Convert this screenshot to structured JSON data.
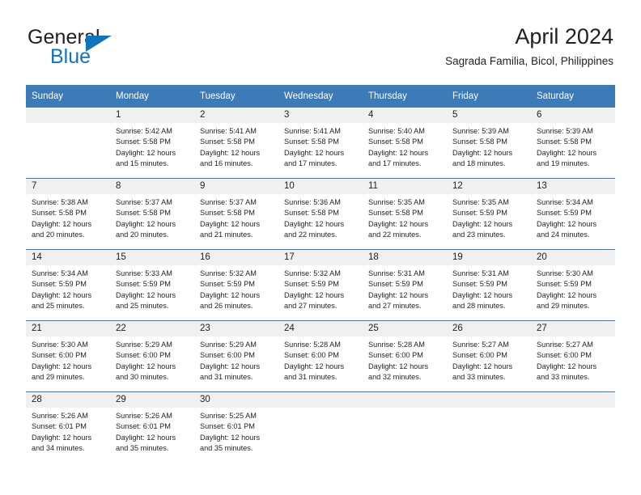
{
  "brand": {
    "name_top": "General",
    "name_bottom": "Blue",
    "triangle_color": "#1073bd"
  },
  "header": {
    "title": "April 2024",
    "subtitle": "Sagrada Familia, Bicol, Philippines"
  },
  "theme": {
    "header_blue": "#3c7ab8",
    "daynum_band": "#f0f0f0",
    "text": "#231f20"
  },
  "calendar": {
    "weekday_headers": [
      "Sunday",
      "Monday",
      "Tuesday",
      "Wednesday",
      "Thursday",
      "Friday",
      "Saturday"
    ],
    "labels": {
      "sunrise_prefix": "Sunrise:",
      "sunset_prefix": "Sunset:",
      "daylight_prefix": "Daylight:"
    },
    "weeks": [
      [
        {
          "day": "",
          "empty": true,
          "sunrise": "",
          "sunset": "",
          "daylight_line1": "",
          "daylight_line2": ""
        },
        {
          "day": "1",
          "empty": false,
          "sunrise": "Sunrise: 5:42 AM",
          "sunset": "Sunset: 5:58 PM",
          "daylight_line1": "Daylight: 12 hours",
          "daylight_line2": "and 15 minutes."
        },
        {
          "day": "2",
          "empty": false,
          "sunrise": "Sunrise: 5:41 AM",
          "sunset": "Sunset: 5:58 PM",
          "daylight_line1": "Daylight: 12 hours",
          "daylight_line2": "and 16 minutes."
        },
        {
          "day": "3",
          "empty": false,
          "sunrise": "Sunrise: 5:41 AM",
          "sunset": "Sunset: 5:58 PM",
          "daylight_line1": "Daylight: 12 hours",
          "daylight_line2": "and 17 minutes."
        },
        {
          "day": "4",
          "empty": false,
          "sunrise": "Sunrise: 5:40 AM",
          "sunset": "Sunset: 5:58 PM",
          "daylight_line1": "Daylight: 12 hours",
          "daylight_line2": "and 17 minutes."
        },
        {
          "day": "5",
          "empty": false,
          "sunrise": "Sunrise: 5:39 AM",
          "sunset": "Sunset: 5:58 PM",
          "daylight_line1": "Daylight: 12 hours",
          "daylight_line2": "and 18 minutes."
        },
        {
          "day": "6",
          "empty": false,
          "sunrise": "Sunrise: 5:39 AM",
          "sunset": "Sunset: 5:58 PM",
          "daylight_line1": "Daylight: 12 hours",
          "daylight_line2": "and 19 minutes."
        }
      ],
      [
        {
          "day": "7",
          "empty": false,
          "sunrise": "Sunrise: 5:38 AM",
          "sunset": "Sunset: 5:58 PM",
          "daylight_line1": "Daylight: 12 hours",
          "daylight_line2": "and 20 minutes."
        },
        {
          "day": "8",
          "empty": false,
          "sunrise": "Sunrise: 5:37 AM",
          "sunset": "Sunset: 5:58 PM",
          "daylight_line1": "Daylight: 12 hours",
          "daylight_line2": "and 20 minutes."
        },
        {
          "day": "9",
          "empty": false,
          "sunrise": "Sunrise: 5:37 AM",
          "sunset": "Sunset: 5:58 PM",
          "daylight_line1": "Daylight: 12 hours",
          "daylight_line2": "and 21 minutes."
        },
        {
          "day": "10",
          "empty": false,
          "sunrise": "Sunrise: 5:36 AM",
          "sunset": "Sunset: 5:58 PM",
          "daylight_line1": "Daylight: 12 hours",
          "daylight_line2": "and 22 minutes."
        },
        {
          "day": "11",
          "empty": false,
          "sunrise": "Sunrise: 5:35 AM",
          "sunset": "Sunset: 5:58 PM",
          "daylight_line1": "Daylight: 12 hours",
          "daylight_line2": "and 22 minutes."
        },
        {
          "day": "12",
          "empty": false,
          "sunrise": "Sunrise: 5:35 AM",
          "sunset": "Sunset: 5:59 PM",
          "daylight_line1": "Daylight: 12 hours",
          "daylight_line2": "and 23 minutes."
        },
        {
          "day": "13",
          "empty": false,
          "sunrise": "Sunrise: 5:34 AM",
          "sunset": "Sunset: 5:59 PM",
          "daylight_line1": "Daylight: 12 hours",
          "daylight_line2": "and 24 minutes."
        }
      ],
      [
        {
          "day": "14",
          "empty": false,
          "sunrise": "Sunrise: 5:34 AM",
          "sunset": "Sunset: 5:59 PM",
          "daylight_line1": "Daylight: 12 hours",
          "daylight_line2": "and 25 minutes."
        },
        {
          "day": "15",
          "empty": false,
          "sunrise": "Sunrise: 5:33 AM",
          "sunset": "Sunset: 5:59 PM",
          "daylight_line1": "Daylight: 12 hours",
          "daylight_line2": "and 25 minutes."
        },
        {
          "day": "16",
          "empty": false,
          "sunrise": "Sunrise: 5:32 AM",
          "sunset": "Sunset: 5:59 PM",
          "daylight_line1": "Daylight: 12 hours",
          "daylight_line2": "and 26 minutes."
        },
        {
          "day": "17",
          "empty": false,
          "sunrise": "Sunrise: 5:32 AM",
          "sunset": "Sunset: 5:59 PM",
          "daylight_line1": "Daylight: 12 hours",
          "daylight_line2": "and 27 minutes."
        },
        {
          "day": "18",
          "empty": false,
          "sunrise": "Sunrise: 5:31 AM",
          "sunset": "Sunset: 5:59 PM",
          "daylight_line1": "Daylight: 12 hours",
          "daylight_line2": "and 27 minutes."
        },
        {
          "day": "19",
          "empty": false,
          "sunrise": "Sunrise: 5:31 AM",
          "sunset": "Sunset: 5:59 PM",
          "daylight_line1": "Daylight: 12 hours",
          "daylight_line2": "and 28 minutes."
        },
        {
          "day": "20",
          "empty": false,
          "sunrise": "Sunrise: 5:30 AM",
          "sunset": "Sunset: 5:59 PM",
          "daylight_line1": "Daylight: 12 hours",
          "daylight_line2": "and 29 minutes."
        }
      ],
      [
        {
          "day": "21",
          "empty": false,
          "sunrise": "Sunrise: 5:30 AM",
          "sunset": "Sunset: 6:00 PM",
          "daylight_line1": "Daylight: 12 hours",
          "daylight_line2": "and 29 minutes."
        },
        {
          "day": "22",
          "empty": false,
          "sunrise": "Sunrise: 5:29 AM",
          "sunset": "Sunset: 6:00 PM",
          "daylight_line1": "Daylight: 12 hours",
          "daylight_line2": "and 30 minutes."
        },
        {
          "day": "23",
          "empty": false,
          "sunrise": "Sunrise: 5:29 AM",
          "sunset": "Sunset: 6:00 PM",
          "daylight_line1": "Daylight: 12 hours",
          "daylight_line2": "and 31 minutes."
        },
        {
          "day": "24",
          "empty": false,
          "sunrise": "Sunrise: 5:28 AM",
          "sunset": "Sunset: 6:00 PM",
          "daylight_line1": "Daylight: 12 hours",
          "daylight_line2": "and 31 minutes."
        },
        {
          "day": "25",
          "empty": false,
          "sunrise": "Sunrise: 5:28 AM",
          "sunset": "Sunset: 6:00 PM",
          "daylight_line1": "Daylight: 12 hours",
          "daylight_line2": "and 32 minutes."
        },
        {
          "day": "26",
          "empty": false,
          "sunrise": "Sunrise: 5:27 AM",
          "sunset": "Sunset: 6:00 PM",
          "daylight_line1": "Daylight: 12 hours",
          "daylight_line2": "and 33 minutes."
        },
        {
          "day": "27",
          "empty": false,
          "sunrise": "Sunrise: 5:27 AM",
          "sunset": "Sunset: 6:00 PM",
          "daylight_line1": "Daylight: 12 hours",
          "daylight_line2": "and 33 minutes."
        }
      ],
      [
        {
          "day": "28",
          "empty": false,
          "sunrise": "Sunrise: 5:26 AM",
          "sunset": "Sunset: 6:01 PM",
          "daylight_line1": "Daylight: 12 hours",
          "daylight_line2": "and 34 minutes."
        },
        {
          "day": "29",
          "empty": false,
          "sunrise": "Sunrise: 5:26 AM",
          "sunset": "Sunset: 6:01 PM",
          "daylight_line1": "Daylight: 12 hours",
          "daylight_line2": "and 35 minutes."
        },
        {
          "day": "30",
          "empty": false,
          "sunrise": "Sunrise: 5:25 AM",
          "sunset": "Sunset: 6:01 PM",
          "daylight_line1": "Daylight: 12 hours",
          "daylight_line2": "and 35 minutes."
        },
        {
          "day": "",
          "empty": true,
          "sunrise": "",
          "sunset": "",
          "daylight_line1": "",
          "daylight_line2": ""
        },
        {
          "day": "",
          "empty": true,
          "sunrise": "",
          "sunset": "",
          "daylight_line1": "",
          "daylight_line2": ""
        },
        {
          "day": "",
          "empty": true,
          "sunrise": "",
          "sunset": "",
          "daylight_line1": "",
          "daylight_line2": ""
        },
        {
          "day": "",
          "empty": true,
          "sunrise": "",
          "sunset": "",
          "daylight_line1": "",
          "daylight_line2": ""
        }
      ]
    ]
  }
}
